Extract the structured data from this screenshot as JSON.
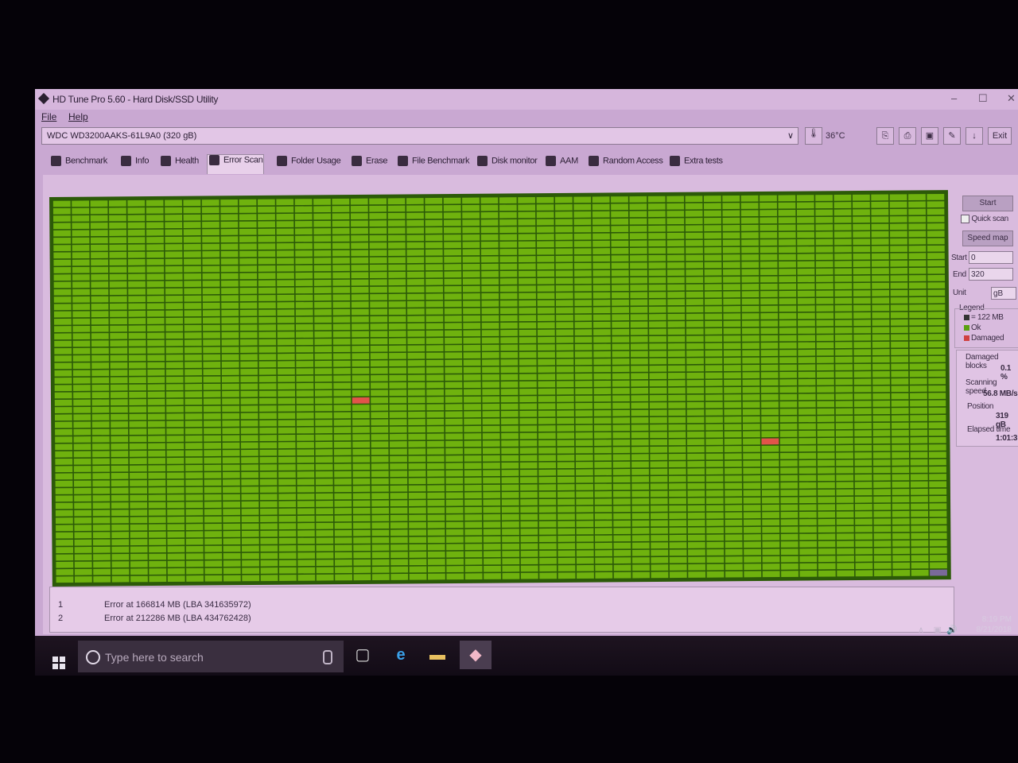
{
  "window": {
    "title": "HD Tune Pro 5.60 - Hard Disk/SSD Utility",
    "controls": [
      "–",
      "☐",
      "✕"
    ]
  },
  "menu": [
    "File",
    "Help"
  ],
  "drive": {
    "selected": "WDC WD3200AAKS-61L9A0 (320 gB)",
    "temperature": "36°C",
    "exit_label": "Exit"
  },
  "tabs": [
    "Benchmark",
    "Info",
    "Health",
    "Error Scan",
    "Folder Usage",
    "Erase",
    "File Benchmark",
    "Disk monitor",
    "AAM",
    "Random Access",
    "Extra tests"
  ],
  "active_tab": "Error Scan",
  "scan_panel": {
    "start_button": "Start",
    "quick_scan_label": "Quick scan",
    "quick_scan_checked": false,
    "speed_map_button": "Speed map",
    "start_label": "Start",
    "start_value": "0",
    "end_label": "End",
    "end_value": "320",
    "unit_label": "Unit",
    "unit_value": "gB",
    "legend_title": "Legend",
    "legend": [
      {
        "text": "= 122 MB",
        "color": "#333333"
      },
      {
        "text": "Ok",
        "color": "#5aa010"
      },
      {
        "text": "Damaged",
        "color": "#d04040"
      }
    ],
    "damaged_blocks_label": "Damaged blocks",
    "damaged_blocks_value": "0.1 %",
    "scanning_speed_label": "Scanning speed",
    "scanning_speed_value": "56.8 MB/s",
    "position_label": "Position",
    "position_value": "319 gB",
    "elapsed_time_label": "Elapsed time",
    "elapsed_time_value": "1:01:3"
  },
  "grid": {
    "columns": 48,
    "rows": 52,
    "ok_color": "#6fb20e",
    "damaged_color": "#e2544a",
    "pending_color": "#7a6a9a",
    "damaged_cells": [
      {
        "col": 16,
        "row": 27
      },
      {
        "col": 38,
        "row": 33
      }
    ],
    "pending_cells": [
      {
        "col": 47,
        "row": 51
      }
    ]
  },
  "error_log": [
    {
      "num": "1",
      "msg": "Error at 166814 MB (LBA 341635972)"
    },
    {
      "num": "2",
      "msg": "Error at 212286 MB (LBA 434762428)"
    }
  ],
  "taskbar": {
    "search_placeholder": "Type here to search",
    "time": "8:19 PM",
    "date": "8/21/2018"
  }
}
